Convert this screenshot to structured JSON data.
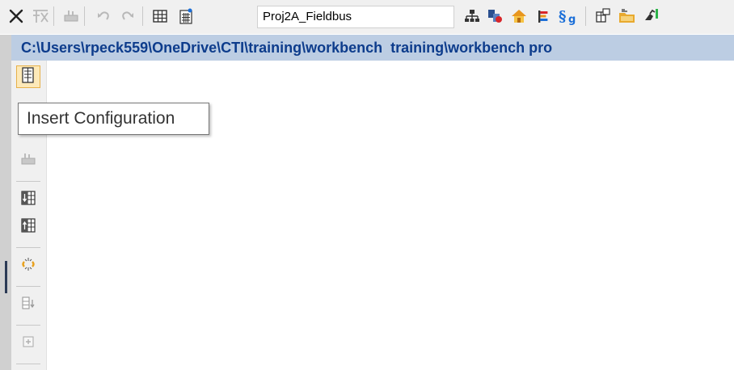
{
  "toolbar": {
    "project_name": "Proj2A_Fieldbus",
    "buttons": [
      {
        "name": "delete-icon",
        "enabled": true
      },
      {
        "name": "delete-all-icon",
        "enabled": false
      },
      {
        "name": "insert-device-icon",
        "enabled": false
      },
      {
        "name": "undo-icon",
        "enabled": false
      },
      {
        "name": "redo-icon",
        "enabled": false
      },
      {
        "name": "grid-view-icon",
        "enabled": true
      },
      {
        "name": "calculator-icon",
        "enabled": true
      },
      {
        "name": "network-icon",
        "enabled": true
      },
      {
        "name": "io-wiring-icon",
        "enabled": true
      },
      {
        "name": "home-icon",
        "enabled": true
      },
      {
        "name": "flag-icon",
        "enabled": true
      },
      {
        "name": "global-defines-icon",
        "enabled": true
      },
      {
        "name": "window-properties-icon",
        "enabled": true
      },
      {
        "name": "open-folder-icon",
        "enabled": true
      },
      {
        "name": "run-icon",
        "enabled": true
      }
    ]
  },
  "path": {
    "text": "C:\\Users\\rpeck559\\OneDrive\\CTI\\training\\workbench  training\\workbench pro"
  },
  "vertical_toolbar": {
    "buttons": [
      {
        "name": "insert-configuration-icon",
        "active": true
      },
      {
        "name": "insert-resource-icon",
        "active": false
      },
      {
        "name": "insert-device-icon",
        "active": false
      },
      {
        "name": "insert-column-before-icon",
        "active": false
      },
      {
        "name": "insert-column-after-icon",
        "active": false
      },
      {
        "name": "link-icon",
        "active": false
      },
      {
        "name": "move-down-icon",
        "active": false
      },
      {
        "name": "expand-icon",
        "active": false
      }
    ]
  },
  "tooltip": {
    "text": "Insert Configuration"
  },
  "colors": {
    "toolbar_bg": "#f0f0f0",
    "path_bar_bg": "#bccde3",
    "path_text": "#0d3c8c",
    "active_button_bg": "#fde9b8",
    "active_button_border": "#e7b14a"
  }
}
